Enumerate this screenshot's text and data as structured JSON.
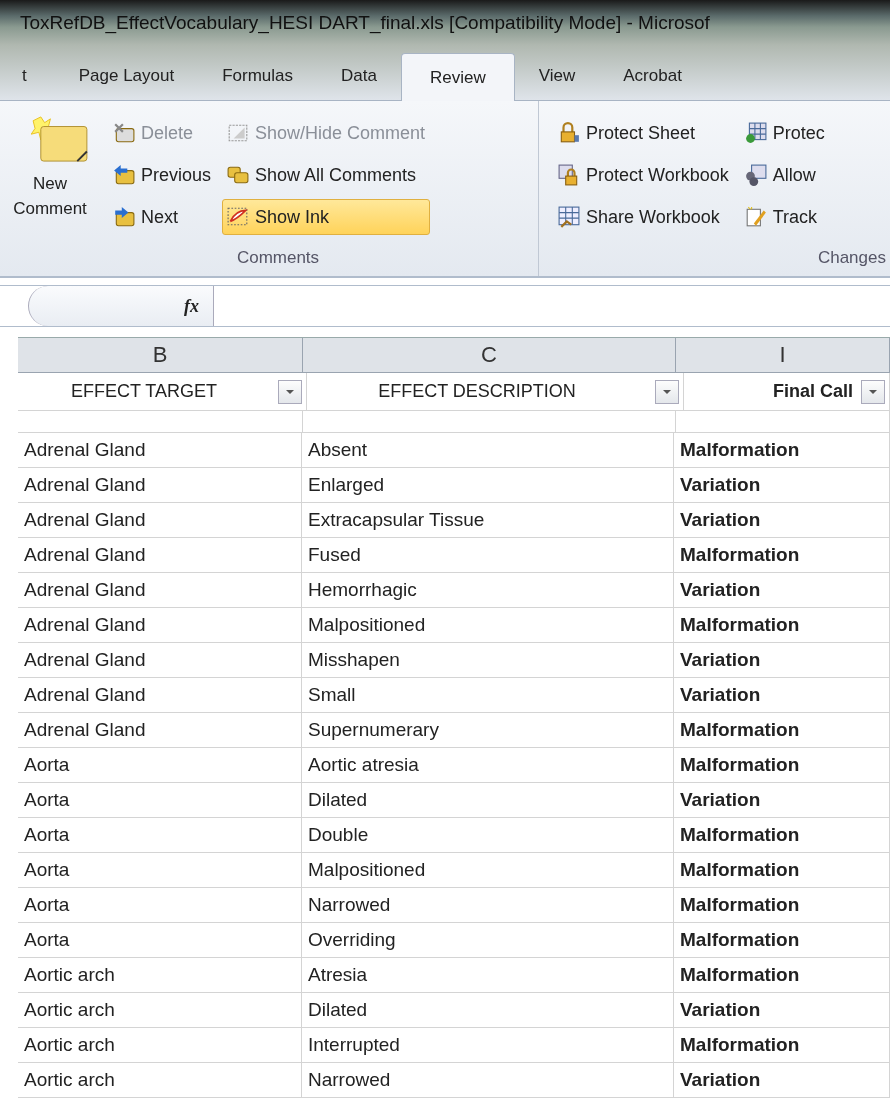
{
  "window": {
    "title": "ToxRefDB_EffectVocabulary_HESI DART_final.xls  [Compatibility Mode]  -  Microsof"
  },
  "tabs": [
    {
      "label": "t",
      "selected": false
    },
    {
      "label": "Page Layout",
      "selected": false
    },
    {
      "label": "Formulas",
      "selected": false
    },
    {
      "label": "Data",
      "selected": false
    },
    {
      "label": "Review",
      "selected": true
    },
    {
      "label": "View",
      "selected": false
    },
    {
      "label": "Acrobat",
      "selected": false
    }
  ],
  "ribbon": {
    "comments": {
      "label": "Comments",
      "new_comment": "New\nComment",
      "column_1": [
        {
          "label": "Delete",
          "disabled": true,
          "kind": "delete"
        },
        {
          "label": "Previous",
          "disabled": false,
          "kind": "previous"
        },
        {
          "label": "Next",
          "disabled": false,
          "kind": "next"
        }
      ],
      "column_2": [
        {
          "label": "Show/Hide Comment",
          "disabled": true,
          "selected": false,
          "kind": "showhide"
        },
        {
          "label": "Show All Comments",
          "disabled": false,
          "selected": false,
          "kind": "showall"
        },
        {
          "label": "Show Ink",
          "disabled": false,
          "selected": true,
          "kind": "ink"
        }
      ]
    },
    "changes": {
      "label": "Changes",
      "column_1": [
        {
          "label": "Protect Sheet",
          "kind": "lock"
        },
        {
          "label": "Protect Workbook",
          "kind": "lockbook"
        },
        {
          "label": "Share Workbook",
          "kind": "share"
        }
      ],
      "column_2": [
        {
          "label": "Protec",
          "kind": "grid"
        },
        {
          "label": "Allow",
          "kind": "users"
        },
        {
          "label": "Track",
          "kind": "track"
        }
      ]
    }
  },
  "formula_bar": {
    "fx": "fx"
  },
  "columns": [
    {
      "letter": "B",
      "heading": "EFFECT TARGET",
      "bold": false
    },
    {
      "letter": "C",
      "heading": "EFFECT DESCRIPTION",
      "bold": false
    },
    {
      "letter": "I",
      "heading": "Final Call",
      "bold": true
    }
  ],
  "rows": [
    [
      "Adrenal Gland",
      "Absent",
      "Malformation"
    ],
    [
      "Adrenal Gland",
      "Enlarged",
      "Variation"
    ],
    [
      "Adrenal Gland",
      "Extracapsular Tissue",
      "Variation"
    ],
    [
      "Adrenal Gland",
      "Fused",
      "Malformation"
    ],
    [
      "Adrenal Gland",
      "Hemorrhagic",
      "Variation"
    ],
    [
      "Adrenal Gland",
      "Malpositioned",
      "Malformation"
    ],
    [
      "Adrenal Gland",
      "Misshapen",
      "Variation"
    ],
    [
      "Adrenal Gland",
      "Small",
      "Variation"
    ],
    [
      "Adrenal Gland",
      "Supernumerary",
      "Malformation"
    ],
    [
      "Aorta",
      "Aortic atresia",
      "Malformation"
    ],
    [
      "Aorta",
      "Dilated",
      "Variation"
    ],
    [
      "Aorta",
      "Double",
      "Malformation"
    ],
    [
      "Aorta",
      "Malpositioned",
      "Malformation"
    ],
    [
      "Aorta",
      "Narrowed",
      "Malformation"
    ],
    [
      "Aorta",
      "Overriding",
      "Malformation"
    ],
    [
      "Aortic arch",
      "Atresia",
      "Malformation"
    ],
    [
      "Aortic arch",
      "Dilated",
      "Variation"
    ],
    [
      "Aortic arch",
      "Interrupted",
      "Malformation"
    ],
    [
      "Aortic arch",
      "Narrowed",
      "Variation"
    ]
  ]
}
